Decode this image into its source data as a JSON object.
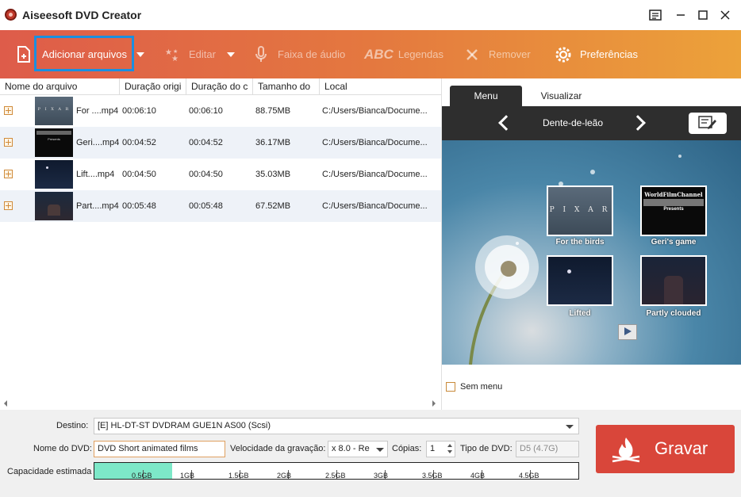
{
  "window": {
    "title": "Aiseesoft DVD Creator"
  },
  "toolbar": {
    "add_files": "Adicionar arquivos",
    "edit": "Editar",
    "audio_track": "Faixa de áudio",
    "subtitles_abc": "ABC",
    "subtitles": "Legendas",
    "remove": "Remover",
    "preferences": "Preferências"
  },
  "filelist": {
    "headers": {
      "name": "Nome do arquivo",
      "original_duration": "Duração origi",
      "output_duration": "Duração do c",
      "size": "Tamanho do",
      "location": "Local"
    },
    "rows": [
      {
        "name": "For ....mp4",
        "orig": "00:06:10",
        "out": "00:06:10",
        "size": "88.75MB",
        "path": "C:/Users/Bianca/Docume..."
      },
      {
        "name": "Geri....mp4",
        "orig": "00:04:52",
        "out": "00:04:52",
        "size": "36.17MB",
        "path": "C:/Users/Bianca/Docume..."
      },
      {
        "name": "Lift....mp4",
        "orig": "00:04:50",
        "out": "00:04:50",
        "size": "35.03MB",
        "path": "C:/Users/Bianca/Docume..."
      },
      {
        "name": "Part....mp4",
        "orig": "00:05:48",
        "out": "00:05:48",
        "size": "67.52MB",
        "path": "C:/Users/Bianca/Docume..."
      }
    ]
  },
  "menu_panel": {
    "tabs": {
      "menu": "Menu",
      "preview": "Visualizar"
    },
    "template_name": "Dente-de-leão",
    "items": [
      {
        "caption": "For the birds",
        "thumb_text": "P I X A R"
      },
      {
        "caption": "Geri's game",
        "thumb_text": "WorldFilmChannel",
        "thumb_sub": "Presents"
      },
      {
        "caption": "Lifted"
      },
      {
        "caption": "Partly clouded"
      }
    ],
    "no_menu": "Sem menu"
  },
  "bottom": {
    "destination_label": "Destino:",
    "destination_value": "[E] HL-DT-ST DVDRAM GUE1N AS00 (Scsi)",
    "dvd_name_label": "Nome do DVD:",
    "dvd_name_value": "DVD Short animated films",
    "burn_speed_label": "Velocidade da gravação:",
    "burn_speed_value": "x 8.0 - Re",
    "copies_label": "Cópias:",
    "copies_value": "1",
    "dvd_type_label": "Tipo de DVD:",
    "dvd_type_value": "D5 (4.7G)",
    "capacity_label": "Capacidade estimada",
    "capacity_ticks": [
      "0.5GB",
      "1GB",
      "1.5GB",
      "2GB",
      "2.5GB",
      "3GB",
      "3.5GB",
      "4GB",
      "4.5GB"
    ],
    "capacity_used_fraction": 0.16,
    "burn_button": "Gravar"
  },
  "colors": {
    "toolbar_start": "#de5c4a",
    "toolbar_end": "#eca23a",
    "highlight_border": "#1a8fe0",
    "burn_button": "#d9463a",
    "capacity_fill": "#7de8c8"
  },
  "icons": [
    "app-logo-icon",
    "add-file-icon",
    "edit-stars-icon",
    "microphone-icon",
    "remove-x-icon",
    "gear-icon",
    "menu-icon",
    "minimize-icon",
    "maximize-icon",
    "close-icon",
    "chevron-left-icon",
    "chevron-right-icon",
    "edit-template-icon",
    "play-icon",
    "flame-icon"
  ]
}
